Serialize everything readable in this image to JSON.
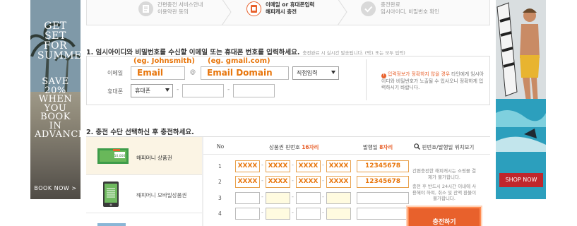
{
  "ad_left": {
    "headline": "GET SET FOR SUMMER",
    "offer": "SAVE 20% WHEN YOU BOOK IN ADVANCE",
    "cta": "BOOK NOW >"
  },
  "ad_right": {
    "cta": "SHOP NOW"
  },
  "steps": [
    {
      "label": "간편충전 서비스안내\n이용약관 동의",
      "icon": "document-icon",
      "active": false
    },
    {
      "label": "이메일 or 휴대폰입력\n해피캐시 충전",
      "icon": "charge-icon",
      "active": true
    },
    {
      "label": "충전완료\n임시아이디, 비밀번호 확인",
      "icon": "check-icon",
      "active": false
    }
  ],
  "section1": {
    "title": "1. 임시아이디와 비밀번호를 수신할 이메일 또는 휴대폰 번호를 입력하세요.",
    "note": "충전완료 시 실시간 발송됩니다. (택1 또는 모두 입력)",
    "email_label": "이메일",
    "email_hint": "(eg. Johnsmith)",
    "email_value": "Email",
    "at_sign": "@",
    "domain_hint": "(eg. gmail.com)",
    "domain_value": "Email Domain",
    "domain_select": "직접입력",
    "phone_label": "휴대폰",
    "phone_select": "휴대폰",
    "notice_em": "입력정보가 정확하지 않을 경우",
    "notice_rest": "타인에게 임시아이디와 비밀번호가 노출될 수 있사오니 정확하게 입력하시기 바랍니다."
  },
  "section2": {
    "title": "2. 충전 수단 선택하신 후 충전하세요.",
    "methods": [
      {
        "label": "해피머니 상품권",
        "selected": true
      },
      {
        "label": "해피머니 모바일상품권",
        "selected": false
      }
    ],
    "col_no": "No",
    "col_pin": "상품권 핀번호",
    "col_pin_em": "16자리",
    "col_date": "발행일",
    "col_date_em": "8자리",
    "col_loc": "핀번호/발행일 위치보기",
    "rows": [
      {
        "no": "1",
        "codes": [
          "XXXX",
          "XXXX",
          "XXXX",
          "XXXX"
        ],
        "date": "12345678"
      },
      {
        "no": "2",
        "codes": [
          "XXXX",
          "XXXX",
          "XXXX",
          "XXXX"
        ],
        "date": "12345678"
      },
      {
        "no": "3",
        "codes": [
          "",
          "",
          "",
          ""
        ],
        "date": ""
      },
      {
        "no": "4",
        "codes": [
          "",
          "",
          "",
          ""
        ],
        "date": ""
      }
    ],
    "side_note_1": "간편충전한 해피캐시는 쇼핑몰 결제가 불가합니다.",
    "side_note_2": "충전 후 반드시 24시간 이내에 사용해야 하며, 취소 및 잔액 환불이 불가합니다.",
    "charge_button": "충전하기"
  }
}
